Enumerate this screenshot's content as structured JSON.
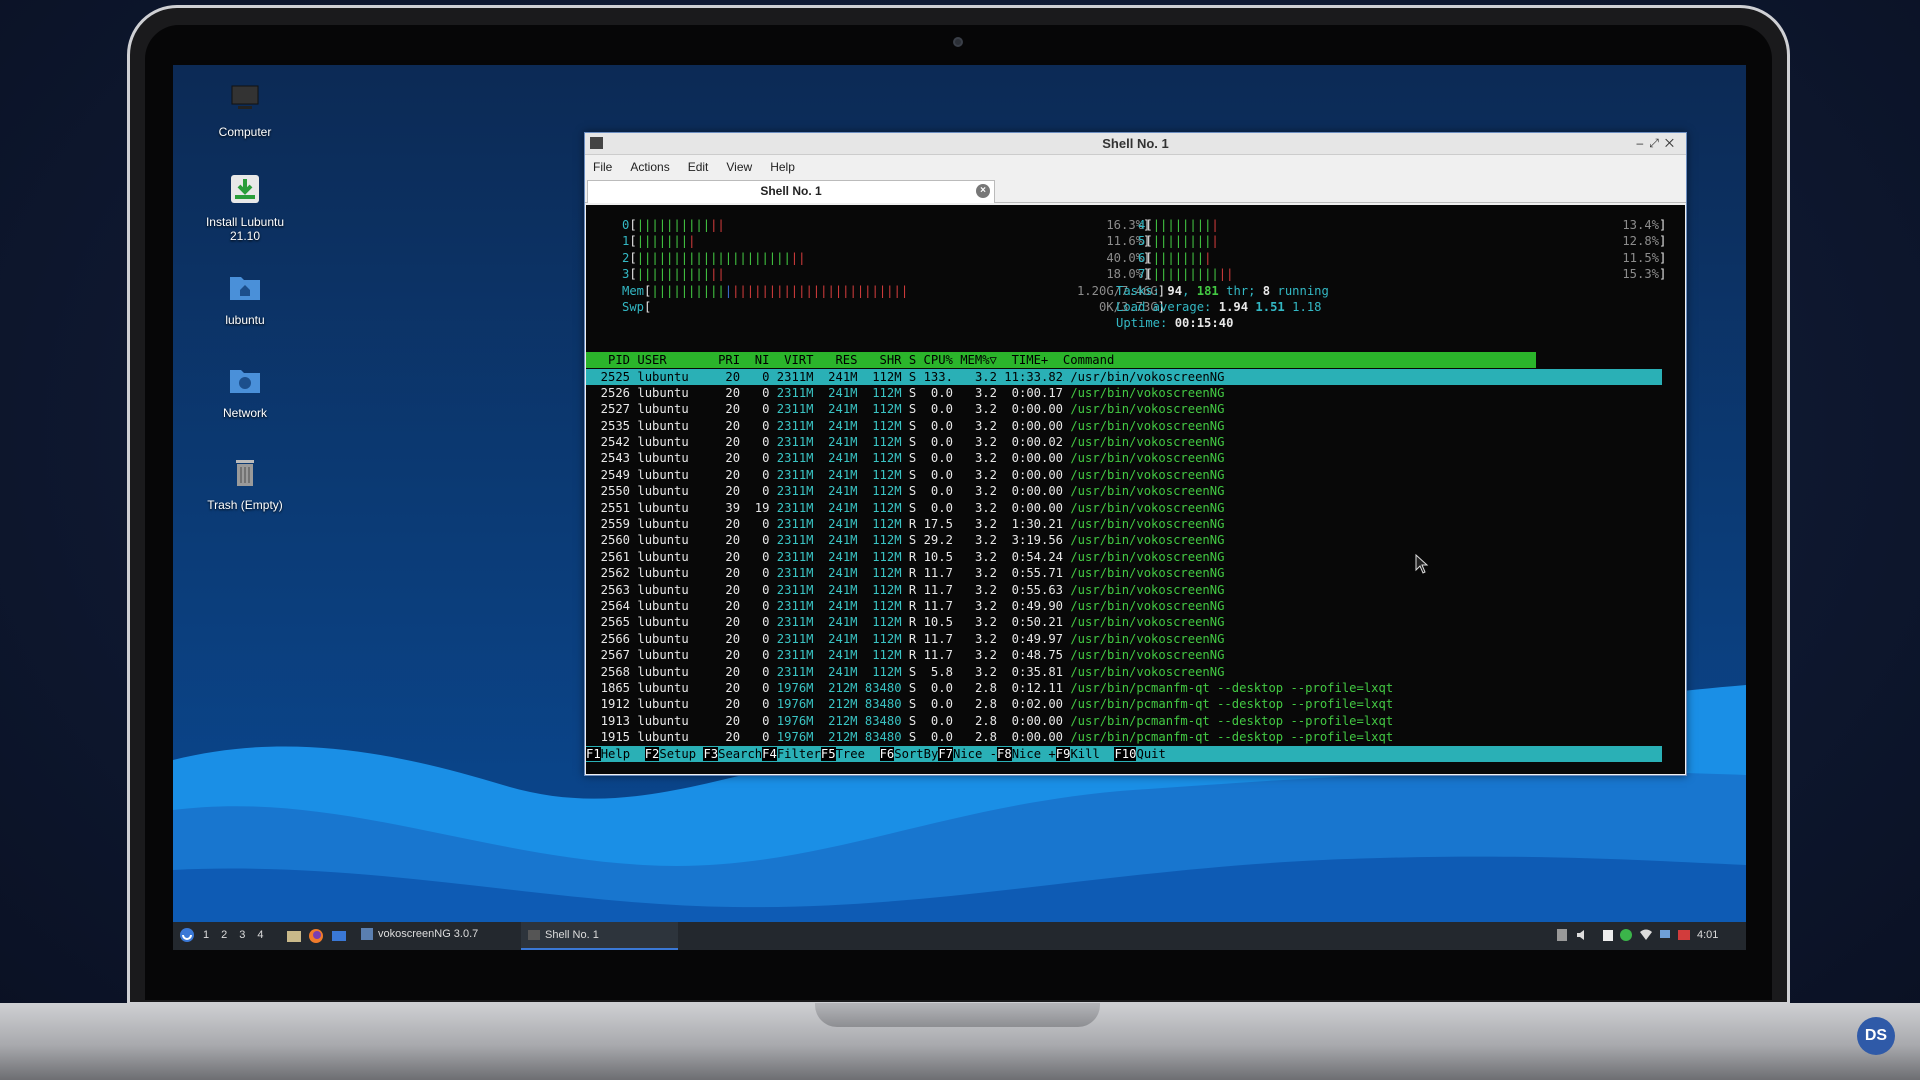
{
  "window": {
    "title": "Shell No. 1"
  },
  "menu": [
    "File",
    "Actions",
    "Edit",
    "View",
    "Help"
  ],
  "tab": {
    "label": "Shell No. 1"
  },
  "desktop_icons": [
    {
      "label": "Computer"
    },
    {
      "label": "Install Lubuntu 21.10"
    },
    {
      "label": "lubuntu"
    },
    {
      "label": "Network"
    },
    {
      "label": "Trash (Empty)"
    }
  ],
  "htop": {
    "cpu_left": [
      {
        "id": "0",
        "bars_g": 10,
        "bars_r": 2,
        "pct": "16.3%"
      },
      {
        "id": "1",
        "bars_g": 7,
        "bars_r": 1,
        "pct": "11.6%"
      },
      {
        "id": "2",
        "bars_g": 21,
        "bars_r": 2,
        "pct": "40.0%"
      },
      {
        "id": "3",
        "bars_g": 10,
        "bars_r": 2,
        "pct": "18.0%"
      }
    ],
    "cpu_right": [
      {
        "id": "4",
        "bars_g": 8,
        "bars_r": 1,
        "pct": "13.4%"
      },
      {
        "id": "5",
        "bars_g": 8,
        "bars_r": 1,
        "pct": "12.8%"
      },
      {
        "id": "6",
        "bars_g": 7,
        "bars_r": 1,
        "pct": "11.5%"
      },
      {
        "id": "7",
        "bars_g": 9,
        "bars_r": 2,
        "pct": "15.3%"
      }
    ],
    "mem": {
      "label": "Mem",
      "value": "1.20G/7.46G"
    },
    "swp": {
      "label": "Swp",
      "value": "0K/3.73G"
    },
    "tasks": {
      "prefix": "Tasks: ",
      "tasks": "94",
      "sep": ", ",
      "thr": "181",
      "thr_label": " thr; ",
      "running": "8",
      "running_label": " running"
    },
    "load": {
      "prefix": "Load average: ",
      "l1": "1.94",
      "l5": "1.51",
      "l15": "1.18"
    },
    "uptime": {
      "prefix": "Uptime: ",
      "value": "00:15:40"
    },
    "header": "   PID USER       PRI  NI  VIRT   RES   SHR S CPU% MEM%▽  TIME+  Command",
    "processes": [
      {
        "pid": "2525",
        "user": "lubuntu",
        "pri": "20",
        "ni": "0",
        "virt": "2311M",
        "res": "241M",
        "shr": "112M",
        "s": "S",
        "cpu": "133.",
        "mem": "3.2",
        "time": "11:33.82",
        "cmd": "/usr/bin/vokoscreenNG"
      },
      {
        "pid": "2526",
        "user": "lubuntu",
        "pri": "20",
        "ni": "0",
        "virt": "2311M",
        "res": "241M",
        "shr": "112M",
        "s": "S",
        "cpu": "0.0",
        "mem": "3.2",
        "time": "0:00.17",
        "cmd": "/usr/bin/vokoscreenNG"
      },
      {
        "pid": "2527",
        "user": "lubuntu",
        "pri": "20",
        "ni": "0",
        "virt": "2311M",
        "res": "241M",
        "shr": "112M",
        "s": "S",
        "cpu": "0.0",
        "mem": "3.2",
        "time": "0:00.00",
        "cmd": "/usr/bin/vokoscreenNG"
      },
      {
        "pid": "2535",
        "user": "lubuntu",
        "pri": "20",
        "ni": "0",
        "virt": "2311M",
        "res": "241M",
        "shr": "112M",
        "s": "S",
        "cpu": "0.0",
        "mem": "3.2",
        "time": "0:00.00",
        "cmd": "/usr/bin/vokoscreenNG"
      },
      {
        "pid": "2542",
        "user": "lubuntu",
        "pri": "20",
        "ni": "0",
        "virt": "2311M",
        "res": "241M",
        "shr": "112M",
        "s": "S",
        "cpu": "0.0",
        "mem": "3.2",
        "time": "0:00.02",
        "cmd": "/usr/bin/vokoscreenNG"
      },
      {
        "pid": "2543",
        "user": "lubuntu",
        "pri": "20",
        "ni": "0",
        "virt": "2311M",
        "res": "241M",
        "shr": "112M",
        "s": "S",
        "cpu": "0.0",
        "mem": "3.2",
        "time": "0:00.00",
        "cmd": "/usr/bin/vokoscreenNG"
      },
      {
        "pid": "2549",
        "user": "lubuntu",
        "pri": "20",
        "ni": "0",
        "virt": "2311M",
        "res": "241M",
        "shr": "112M",
        "s": "S",
        "cpu": "0.0",
        "mem": "3.2",
        "time": "0:00.00",
        "cmd": "/usr/bin/vokoscreenNG"
      },
      {
        "pid": "2550",
        "user": "lubuntu",
        "pri": "20",
        "ni": "0",
        "virt": "2311M",
        "res": "241M",
        "shr": "112M",
        "s": "S",
        "cpu": "0.0",
        "mem": "3.2",
        "time": "0:00.00",
        "cmd": "/usr/bin/vokoscreenNG"
      },
      {
        "pid": "2551",
        "user": "lubuntu",
        "pri": "39",
        "ni": "19",
        "virt": "2311M",
        "res": "241M",
        "shr": "112M",
        "s": "S",
        "cpu": "0.0",
        "mem": "3.2",
        "time": "0:00.00",
        "cmd": "/usr/bin/vokoscreenNG"
      },
      {
        "pid": "2559",
        "user": "lubuntu",
        "pri": "20",
        "ni": "0",
        "virt": "2311M",
        "res": "241M",
        "shr": "112M",
        "s": "R",
        "cpu": "17.5",
        "mem": "3.2",
        "time": "1:30.21",
        "cmd": "/usr/bin/vokoscreenNG"
      },
      {
        "pid": "2560",
        "user": "lubuntu",
        "pri": "20",
        "ni": "0",
        "virt": "2311M",
        "res": "241M",
        "shr": "112M",
        "s": "S",
        "cpu": "29.2",
        "mem": "3.2",
        "time": "3:19.56",
        "cmd": "/usr/bin/vokoscreenNG"
      },
      {
        "pid": "2561",
        "user": "lubuntu",
        "pri": "20",
        "ni": "0",
        "virt": "2311M",
        "res": "241M",
        "shr": "112M",
        "s": "R",
        "cpu": "10.5",
        "mem": "3.2",
        "time": "0:54.24",
        "cmd": "/usr/bin/vokoscreenNG"
      },
      {
        "pid": "2562",
        "user": "lubuntu",
        "pri": "20",
        "ni": "0",
        "virt": "2311M",
        "res": "241M",
        "shr": "112M",
        "s": "R",
        "cpu": "11.7",
        "mem": "3.2",
        "time": "0:55.71",
        "cmd": "/usr/bin/vokoscreenNG"
      },
      {
        "pid": "2563",
        "user": "lubuntu",
        "pri": "20",
        "ni": "0",
        "virt": "2311M",
        "res": "241M",
        "shr": "112M",
        "s": "R",
        "cpu": "11.7",
        "mem": "3.2",
        "time": "0:55.63",
        "cmd": "/usr/bin/vokoscreenNG"
      },
      {
        "pid": "2564",
        "user": "lubuntu",
        "pri": "20",
        "ni": "0",
        "virt": "2311M",
        "res": "241M",
        "shr": "112M",
        "s": "R",
        "cpu": "11.7",
        "mem": "3.2",
        "time": "0:49.90",
        "cmd": "/usr/bin/vokoscreenNG"
      },
      {
        "pid": "2565",
        "user": "lubuntu",
        "pri": "20",
        "ni": "0",
        "virt": "2311M",
        "res": "241M",
        "shr": "112M",
        "s": "R",
        "cpu": "10.5",
        "mem": "3.2",
        "time": "0:50.21",
        "cmd": "/usr/bin/vokoscreenNG"
      },
      {
        "pid": "2566",
        "user": "lubuntu",
        "pri": "20",
        "ni": "0",
        "virt": "2311M",
        "res": "241M",
        "shr": "112M",
        "s": "R",
        "cpu": "11.7",
        "mem": "3.2",
        "time": "0:49.97",
        "cmd": "/usr/bin/vokoscreenNG"
      },
      {
        "pid": "2567",
        "user": "lubuntu",
        "pri": "20",
        "ni": "0",
        "virt": "2311M",
        "res": "241M",
        "shr": "112M",
        "s": "R",
        "cpu": "11.7",
        "mem": "3.2",
        "time": "0:48.75",
        "cmd": "/usr/bin/vokoscreenNG"
      },
      {
        "pid": "2568",
        "user": "lubuntu",
        "pri": "20",
        "ni": "0",
        "virt": "2311M",
        "res": "241M",
        "shr": "112M",
        "s": "S",
        "cpu": "5.8",
        "mem": "3.2",
        "time": "0:35.81",
        "cmd": "/usr/bin/vokoscreenNG"
      },
      {
        "pid": "1865",
        "user": "lubuntu",
        "pri": "20",
        "ni": "0",
        "virt": "1976M",
        "res": "212M",
        "shr": "83480",
        "s": "S",
        "cpu": "0.0",
        "mem": "2.8",
        "time": "0:12.11",
        "cmd": "/usr/bin/pcmanfm-qt --desktop --profile=lxqt"
      },
      {
        "pid": "1912",
        "user": "lubuntu",
        "pri": "20",
        "ni": "0",
        "virt": "1976M",
        "res": "212M",
        "shr": "83480",
        "s": "S",
        "cpu": "0.0",
        "mem": "2.8",
        "time": "0:02.00",
        "cmd": "/usr/bin/pcmanfm-qt --desktop --profile=lxqt"
      },
      {
        "pid": "1913",
        "user": "lubuntu",
        "pri": "20",
        "ni": "0",
        "virt": "1976M",
        "res": "212M",
        "shr": "83480",
        "s": "S",
        "cpu": "0.0",
        "mem": "2.8",
        "time": "0:00.00",
        "cmd": "/usr/bin/pcmanfm-qt --desktop --profile=lxqt"
      },
      {
        "pid": "1915",
        "user": "lubuntu",
        "pri": "20",
        "ni": "0",
        "virt": "1976M",
        "res": "212M",
        "shr": "83480",
        "s": "S",
        "cpu": "0.0",
        "mem": "2.8",
        "time": "0:00.00",
        "cmd": "/usr/bin/pcmanfm-qt --desktop --profile=lxqt"
      }
    ],
    "fkeys": [
      {
        "k": "F1",
        "v": "Help  "
      },
      {
        "k": "F2",
        "v": "Setup "
      },
      {
        "k": "F3",
        "v": "Search"
      },
      {
        "k": "F4",
        "v": "Filter"
      },
      {
        "k": "F5",
        "v": "Tree  "
      },
      {
        "k": "F6",
        "v": "SortBy"
      },
      {
        "k": "F7",
        "v": "Nice -"
      },
      {
        "k": "F8",
        "v": "Nice +"
      },
      {
        "k": "F9",
        "v": "Kill  "
      },
      {
        "k": "F10",
        "v": "Quit"
      }
    ]
  },
  "taskbar": {
    "desktops": [
      "1",
      "2",
      "3",
      "4"
    ],
    "apps": [
      {
        "label": "vokoscreenNG 3.0.7"
      },
      {
        "label": "Shell No. 1"
      }
    ],
    "clock": "4:01"
  },
  "badge": "DS",
  "colors": {
    "term_bg": "#080808",
    "htop_green": "#43c943",
    "htop_cyan": "#2ab0b6",
    "selection": "#2ab0b6"
  }
}
